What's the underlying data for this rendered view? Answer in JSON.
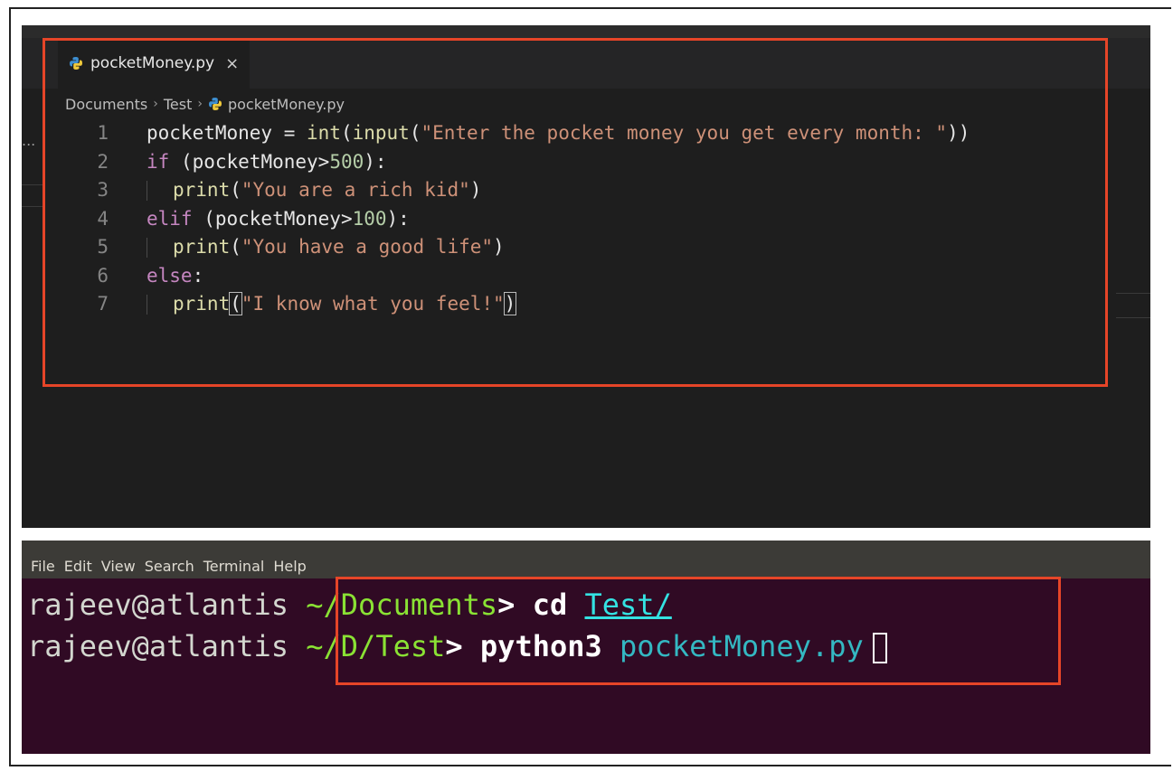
{
  "editor": {
    "tab": {
      "filename": "pocketMoney.py",
      "close_glyph": "×"
    },
    "breadcrumb": {
      "items": [
        "Documents",
        "Test",
        "pocketMoney.py"
      ],
      "separator": "›"
    },
    "gutter_overflow": "...",
    "code_lines": [
      {
        "num": "1",
        "tokens": [
          {
            "t": "pocketMoney",
            "c": "var"
          },
          {
            "t": " = ",
            "c": "op"
          },
          {
            "t": "int",
            "c": "fn"
          },
          {
            "t": "(",
            "c": "op"
          },
          {
            "t": "input",
            "c": "fn"
          },
          {
            "t": "(",
            "c": "op"
          },
          {
            "t": "\"Enter the pocket money you get every month: \"",
            "c": "str"
          },
          {
            "t": "))",
            "c": "op"
          }
        ]
      },
      {
        "num": "2",
        "tokens": [
          {
            "t": "if",
            "c": "kw"
          },
          {
            "t": " (pocketMoney>",
            "c": "var"
          },
          {
            "t": "500",
            "c": "num"
          },
          {
            "t": "):",
            "c": "op"
          }
        ]
      },
      {
        "num": "3",
        "indent": true,
        "tokens": [
          {
            "t": "print",
            "c": "fn"
          },
          {
            "t": "(",
            "c": "op"
          },
          {
            "t": "\"You are a rich kid\"",
            "c": "str"
          },
          {
            "t": ")",
            "c": "op"
          }
        ]
      },
      {
        "num": "4",
        "tokens": [
          {
            "t": "elif",
            "c": "kw"
          },
          {
            "t": " (pocketMoney>",
            "c": "var"
          },
          {
            "t": "100",
            "c": "num"
          },
          {
            "t": "):",
            "c": "op"
          }
        ]
      },
      {
        "num": "5",
        "indent": true,
        "tokens": [
          {
            "t": "print",
            "c": "fn"
          },
          {
            "t": "(",
            "c": "op"
          },
          {
            "t": "\"You have a good life\"",
            "c": "str"
          },
          {
            "t": ")",
            "c": "op"
          }
        ]
      },
      {
        "num": "6",
        "tokens": [
          {
            "t": "else",
            "c": "kw"
          },
          {
            "t": ":",
            "c": "op"
          }
        ]
      },
      {
        "num": "7",
        "indent": true,
        "tokens": [
          {
            "t": "print",
            "c": "fn"
          },
          {
            "t": "(",
            "c": "op",
            "hl": true
          },
          {
            "t": "\"I know what you feel!\"",
            "c": "str"
          },
          {
            "t": ")",
            "c": "op",
            "hl": true
          }
        ]
      }
    ]
  },
  "terminal": {
    "menu": [
      "File",
      "Edit",
      "View",
      "Search",
      "Terminal",
      "Help"
    ],
    "lines": [
      {
        "user": "rajeev@atlantis",
        "path": "~/Documents",
        "prompt": ">",
        "cmd": "cd",
        "arg": "Test/",
        "arg_type": "dir"
      },
      {
        "user": "rajeev@atlantis",
        "path": "~/D/Test",
        "prompt": ">",
        "cmd": "python3",
        "arg": "pocketMoney.py",
        "arg_type": "file",
        "cursor": true
      }
    ]
  },
  "colors": {
    "highlight_box": "#e64528",
    "editor_bg": "#1e1e1e",
    "terminal_bg": "#300a24"
  }
}
